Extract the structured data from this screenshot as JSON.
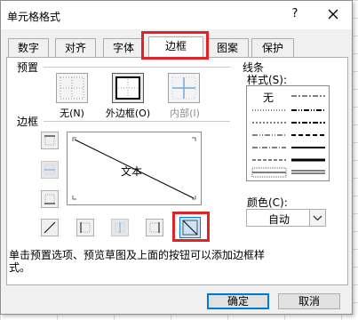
{
  "window": {
    "title": "单元格格式",
    "help_glyph": "?"
  },
  "tabs": [
    {
      "label": "数字"
    },
    {
      "label": "对齐"
    },
    {
      "label": "字体"
    },
    {
      "label": "边框",
      "active": true
    },
    {
      "label": "图案"
    },
    {
      "label": "保护"
    }
  ],
  "presets": {
    "group_label": "预置",
    "none_label": "无(N)",
    "outline_label": "外边框(O)",
    "inside_label": "内部(I)"
  },
  "border": {
    "group_label": "边框",
    "preview_text": "文本"
  },
  "line": {
    "group_label": "线条",
    "style_label": "样式(S):",
    "none_option": "无",
    "color_label": "颜色(C):",
    "color_value": "自动"
  },
  "instructions": "单击预置选项、预览草图及上面的按钮可以添加边框样式。",
  "buttons": {
    "ok": "确定",
    "cancel": "取消"
  },
  "colors": {
    "highlight": "#e02424",
    "accent_blue": "#0078d7",
    "inside_blue": "#6fa8dc"
  }
}
